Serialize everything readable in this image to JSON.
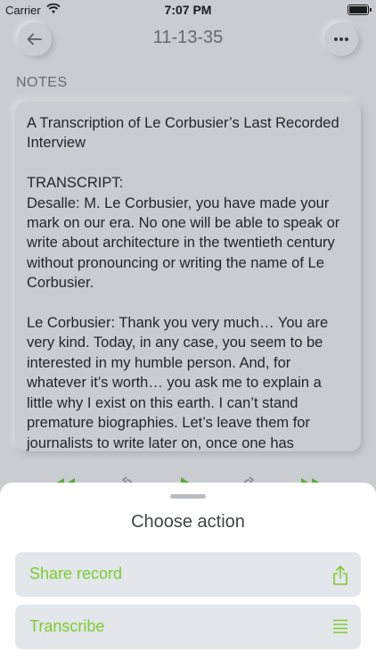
{
  "status_bar": {
    "carrier": "Carrier",
    "time": "7:07 PM"
  },
  "nav": {
    "title": "11-13-35",
    "back_icon": "chevron-left-icon",
    "more_icon": "ellipsis-icon"
  },
  "notes": {
    "label": "NOTES",
    "text": "A Transcription of Le Corbusier’s Last Recorded Interview\n\nTRANSCRIPT:\nDesalle: M. Le Corbusier, you have made your mark on our era. No one will be able to speak or write about architecture in the twentieth century without pronouncing or writing the name of Le Corbusier.\n\nLe Corbusier: Thank you very much… You are very kind. Today, in any case, you seem to be interested in my humble person. And, for whatever it’s worth… you ask me to explain a little why I exist on this earth. I can’t stand premature biographies. Let’s leave them for journalists to write later on, once one has"
  },
  "player": {
    "icons": [
      "rewind-icon",
      "replay-icon",
      "play-icon",
      "forward-icon",
      "fast-forward-icon"
    ],
    "accent": "#5fc22a"
  },
  "action_sheet": {
    "title": "Choose action",
    "actions": [
      {
        "label": "Share record",
        "icon": "share-icon"
      },
      {
        "label": "Transcribe",
        "icon": "lines-icon"
      }
    ],
    "accent": "#7ccc2e"
  }
}
